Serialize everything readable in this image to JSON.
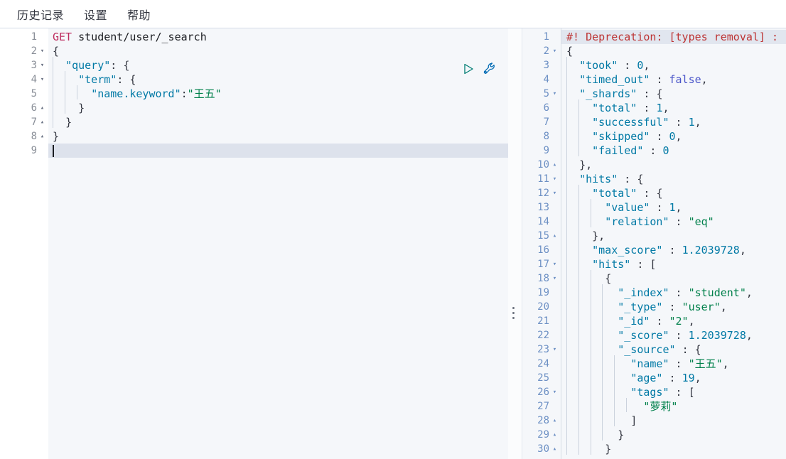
{
  "menubar": {
    "items": [
      {
        "label": "历史记录",
        "name": "menu-history"
      },
      {
        "label": "设置",
        "name": "menu-settings"
      },
      {
        "label": "帮助",
        "name": "menu-help"
      }
    ]
  },
  "actions": {
    "run": {
      "label": "▷",
      "icon": "play-icon",
      "color": "#017d73"
    },
    "wrench": {
      "label": "",
      "icon": "wrench-icon",
      "color": "#006bb4"
    }
  },
  "request_editor": {
    "name": "request-editor",
    "line_count": 9,
    "active_line": 9,
    "lines": [
      {
        "n": "1",
        "fold": "",
        "text": "GET student/user/_search"
      },
      {
        "n": "2",
        "fold": "▾",
        "text": "{"
      },
      {
        "n": "3",
        "fold": "▾",
        "text": "  \"query\": {"
      },
      {
        "n": "4",
        "fold": "▾",
        "text": "    \"term\": {"
      },
      {
        "n": "5",
        "fold": "",
        "text": "      \"name.keyword\":\"王五\""
      },
      {
        "n": "6",
        "fold": "▴",
        "text": "    }"
      },
      {
        "n": "7",
        "fold": "▴",
        "text": "  }"
      },
      {
        "n": "8",
        "fold": "▴",
        "text": "}"
      },
      {
        "n": "9",
        "fold": "",
        "text": ""
      }
    ],
    "method": "GET",
    "path": "student/user/_search",
    "body": {
      "query": {
        "term": {
          "name.keyword": "王五"
        }
      }
    }
  },
  "response_editor": {
    "name": "response-editor",
    "line_count": 30,
    "active_line": 1,
    "deprecation_warning": "#! Deprecation: [types removal]",
    "lines": [
      {
        "n": "1",
        "fold": "",
        "text": "#! Deprecation: [types removal] :"
      },
      {
        "n": "2",
        "fold": "▾",
        "text": "{"
      },
      {
        "n": "3",
        "fold": "",
        "text": "  \"took\" : 0,"
      },
      {
        "n": "4",
        "fold": "",
        "text": "  \"timed_out\" : false,"
      },
      {
        "n": "5",
        "fold": "▾",
        "text": "  \"_shards\" : {"
      },
      {
        "n": "6",
        "fold": "",
        "text": "    \"total\" : 1,"
      },
      {
        "n": "7",
        "fold": "",
        "text": "    \"successful\" : 1,"
      },
      {
        "n": "8",
        "fold": "",
        "text": "    \"skipped\" : 0,"
      },
      {
        "n": "9",
        "fold": "",
        "text": "    \"failed\" : 0"
      },
      {
        "n": "10",
        "fold": "▴",
        "text": "  },"
      },
      {
        "n": "11",
        "fold": "▾",
        "text": "  \"hits\" : {"
      },
      {
        "n": "12",
        "fold": "▾",
        "text": "    \"total\" : {"
      },
      {
        "n": "13",
        "fold": "",
        "text": "      \"value\" : 1,"
      },
      {
        "n": "14",
        "fold": "",
        "text": "      \"relation\" : \"eq\""
      },
      {
        "n": "15",
        "fold": "▴",
        "text": "    },"
      },
      {
        "n": "16",
        "fold": "",
        "text": "    \"max_score\" : 1.2039728,"
      },
      {
        "n": "17",
        "fold": "▾",
        "text": "    \"hits\" : ["
      },
      {
        "n": "18",
        "fold": "▾",
        "text": "      {"
      },
      {
        "n": "19",
        "fold": "",
        "text": "        \"_index\" : \"student\","
      },
      {
        "n": "20",
        "fold": "",
        "text": "        \"_type\" : \"user\","
      },
      {
        "n": "21",
        "fold": "",
        "text": "        \"_id\" : \"2\","
      },
      {
        "n": "22",
        "fold": "",
        "text": "        \"_score\" : 1.2039728,"
      },
      {
        "n": "23",
        "fold": "▾",
        "text": "        \"_source\" : {"
      },
      {
        "n": "24",
        "fold": "",
        "text": "          \"name\" : \"王五\","
      },
      {
        "n": "25",
        "fold": "",
        "text": "          \"age\" : 19,"
      },
      {
        "n": "26",
        "fold": "▾",
        "text": "          \"tags\" : ["
      },
      {
        "n": "27",
        "fold": "",
        "text": "            \"萝莉\""
      },
      {
        "n": "28",
        "fold": "▴",
        "text": "          ]"
      },
      {
        "n": "29",
        "fold": "▴",
        "text": "        }"
      },
      {
        "n": "30",
        "fold": "▴",
        "text": "      }"
      }
    ],
    "result": {
      "took": 0,
      "timed_out": false,
      "_shards": {
        "total": 1,
        "successful": 1,
        "skipped": 0,
        "failed": 0
      },
      "hits": {
        "total": {
          "value": 1,
          "relation": "eq"
        },
        "max_score": 1.2039728,
        "hits": [
          {
            "_index": "student",
            "_type": "user",
            "_id": "2",
            "_score": 1.2039728,
            "_source": {
              "name": "王五",
              "age": 19,
              "tags": [
                "萝莉"
              ]
            }
          }
        ]
      }
    }
  },
  "colors": {
    "method": "#bd2b5e",
    "key": "#0079a5",
    "string": "#00804b",
    "boolean": "#4a55c9",
    "warning": "#bd3434",
    "run_icon": "#017d73",
    "wrench_icon": "#006bb4",
    "active_line": "#dde2ec"
  }
}
